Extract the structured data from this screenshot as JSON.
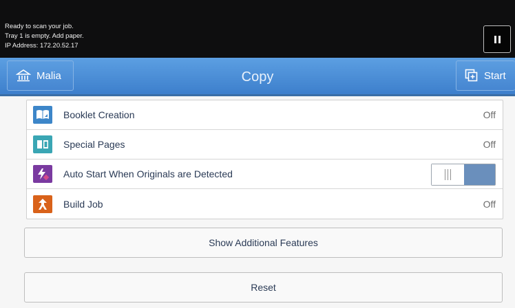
{
  "status": {
    "line1": "Ready to scan your job.",
    "line2": "Tray 1 is empty.  Add paper.",
    "line3": "IP Address: 172.20.52.17"
  },
  "header": {
    "home_label": "Malia",
    "title": "Copy",
    "start_label": "Start"
  },
  "features": [
    {
      "label": "Booklet Creation",
      "value": "Off",
      "icon": "booklet-icon",
      "color": "#3d86c9"
    },
    {
      "label": "Special Pages",
      "value": "Off",
      "icon": "special-pages-icon",
      "color": "#3aa6b4"
    },
    {
      "label": "Auto Start When Originals are Detected",
      "value": "",
      "icon": "auto-start-icon",
      "color": "#7a3aa0",
      "toggle": "off"
    },
    {
      "label": "Build Job",
      "value": "Off",
      "icon": "build-job-icon",
      "color": "#d9621a"
    }
  ],
  "buttons": {
    "more_label": "Show Additional Features",
    "reset_label": "Reset"
  }
}
